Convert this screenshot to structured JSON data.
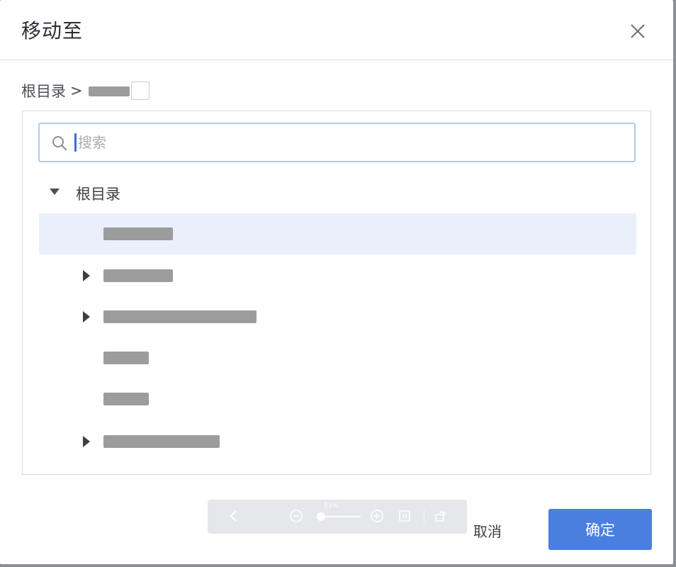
{
  "dialog": {
    "title": "移动至",
    "close_icon": "close-icon"
  },
  "breadcrumb": {
    "root": "根目录",
    "separator": ">"
  },
  "search": {
    "placeholder": "搜索",
    "value": ""
  },
  "tree": {
    "root_label": "根目录",
    "root_expanded": true,
    "items": [
      {
        "label": "",
        "expandable": false,
        "selected": true
      },
      {
        "label": "",
        "expandable": true,
        "selected": false
      },
      {
        "label": "",
        "expandable": true,
        "selected": false
      },
      {
        "label": "",
        "expandable": false,
        "selected": false
      },
      {
        "label": "",
        "expandable": false,
        "selected": false
      },
      {
        "label": "",
        "expandable": true,
        "selected": false
      }
    ]
  },
  "footer": {
    "cancel_label": "取消",
    "confirm_label": "确定"
  },
  "viewer_toolbar": {
    "zoom_label": "53%",
    "icons": [
      "chevron-left-icon",
      "zoom-out-icon",
      "zoom-in-icon",
      "fit-screen-icon",
      "rotate-icon"
    ]
  },
  "colors": {
    "primary": "#4a7fe0",
    "selected_row": "#e9f0fb",
    "search_border": "#b7c8e8"
  }
}
